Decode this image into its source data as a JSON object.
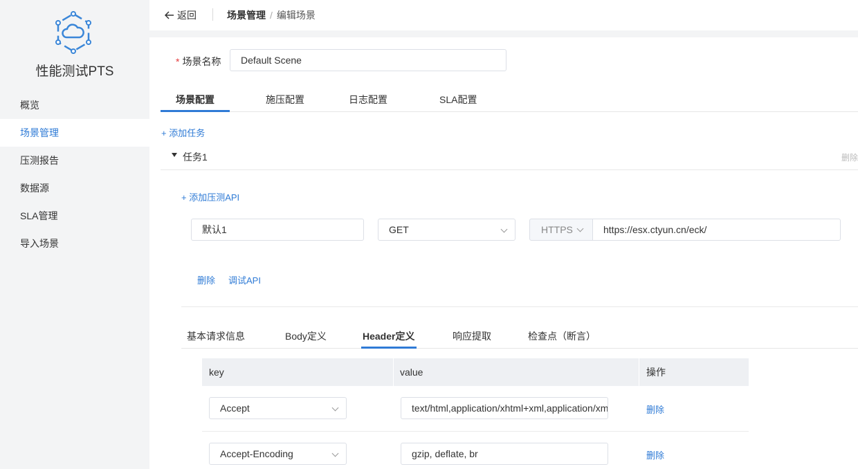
{
  "sidebar": {
    "brand": "性能测试PTS",
    "items": [
      {
        "label": "概览"
      },
      {
        "label": "场景管理"
      },
      {
        "label": "压测报告"
      },
      {
        "label": "数据源"
      },
      {
        "label": "SLA管理"
      },
      {
        "label": "导入场景"
      }
    ],
    "active_index": 1
  },
  "header": {
    "back_label": "返回",
    "breadcrumb": [
      "场景管理",
      "编辑场景"
    ],
    "separator": "/"
  },
  "scene": {
    "name_required_mark": "*",
    "name_label": "场景名称",
    "name_value": "Default Scene"
  },
  "config_tabs": [
    {
      "label": "场景配置"
    },
    {
      "label": "施压配置"
    },
    {
      "label": "日志配置"
    },
    {
      "label": "SLA配置"
    }
  ],
  "add_task_label": "+ 添加任务",
  "task": {
    "title": "任务1",
    "delete_label": "删除",
    "add_api_label": "+ 添加压测API",
    "api": {
      "name_value": "默认1",
      "method_value": "GET",
      "protocol_value": "HTTPS",
      "url_value": "https://esx.ctyun.cn/eck/",
      "delete_label": "删除",
      "debug_label": "调试API"
    }
  },
  "detail_tabs": [
    {
      "label": "基本请求信息"
    },
    {
      "label": "Body定义"
    },
    {
      "label": "Header定义"
    },
    {
      "label": "响应提取"
    },
    {
      "label": "检查点（断言）"
    }
  ],
  "header_table": {
    "columns": [
      "key",
      "value",
      "操作"
    ],
    "rows": [
      {
        "key": "Accept",
        "value": "text/html,application/xhtml+xml,application/xml",
        "action": "删除"
      },
      {
        "key": "Accept-Encoding",
        "value": "gzip, deflate, br",
        "action": "删除"
      }
    ]
  },
  "colors": {
    "accent": "#2f7bd6",
    "required": "#e4393c"
  }
}
